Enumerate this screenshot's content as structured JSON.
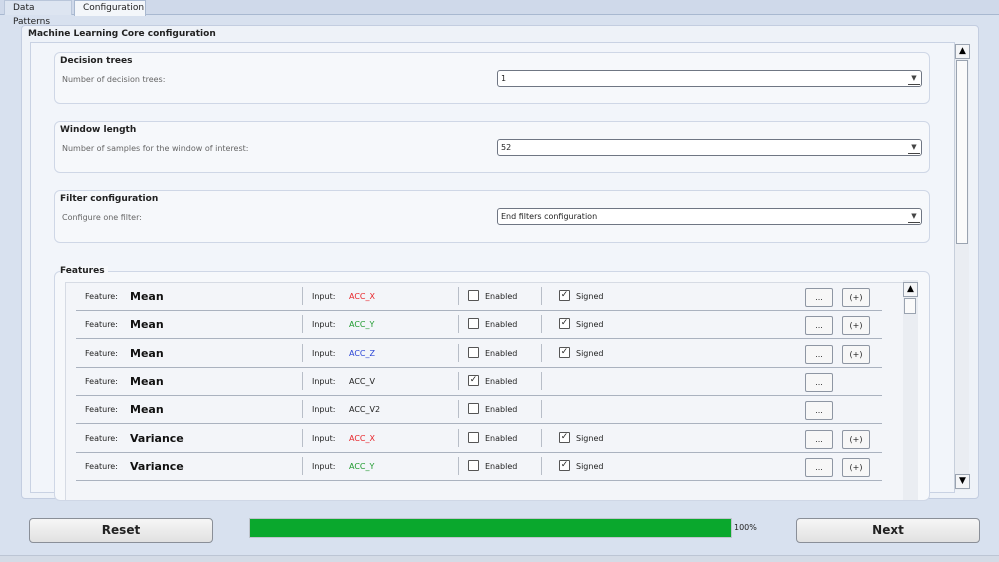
{
  "tabs": [
    {
      "label": "Data Patterns",
      "active": false
    },
    {
      "label": "Configuration",
      "active": true
    }
  ],
  "panel": {
    "title": "Machine Learning Core configuration"
  },
  "decision_trees": {
    "title": "Decision trees",
    "label": "Number of decision trees:",
    "value": "1"
  },
  "window_length": {
    "title": "Window length",
    "label": "Number of samples for the window of interest:",
    "value": "52"
  },
  "filter_config": {
    "title": "Filter configuration",
    "label": "Configure one filter:",
    "value": "End filters configuration"
  },
  "features": {
    "title": "Features",
    "feature_label": "Feature:",
    "input_label": "Input:",
    "enabled_label": "Enabled",
    "signed_label": "Signed",
    "more_button": "...",
    "add_button": "(+)",
    "rows": [
      {
        "name": "Mean",
        "input": "ACC_X",
        "input_color": "#e8262b",
        "enabled": false,
        "signed": true
      },
      {
        "name": "Mean",
        "input": "ACC_Y",
        "input_color": "#1f9a2e",
        "enabled": false,
        "signed": true
      },
      {
        "name": "Mean",
        "input": "ACC_Z",
        "input_color": "#2b45d6",
        "enabled": false,
        "signed": true
      },
      {
        "name": "Mean",
        "input": "ACC_V",
        "input_color": "#222222",
        "enabled": true,
        "signed": null
      },
      {
        "name": "Mean",
        "input": "ACC_V2",
        "input_color": "#222222",
        "enabled": false,
        "signed": null
      },
      {
        "name": "Variance",
        "input": "ACC_X",
        "input_color": "#e8262b",
        "enabled": false,
        "signed": true
      },
      {
        "name": "Variance",
        "input": "ACC_Y",
        "input_color": "#1f9a2e",
        "enabled": false,
        "signed": true
      }
    ]
  },
  "scroll_up_glyph": "▲",
  "scroll_down_glyph": "▼",
  "combo_arrow_glyph": "▼",
  "check_glyph": "✓",
  "footer": {
    "reset_label": "Reset",
    "next_label": "Next",
    "progress_percent": 100,
    "progress_text": "100%"
  },
  "colors": {
    "progress_fill": "#0aa82d",
    "accent": "#2b45d6"
  }
}
